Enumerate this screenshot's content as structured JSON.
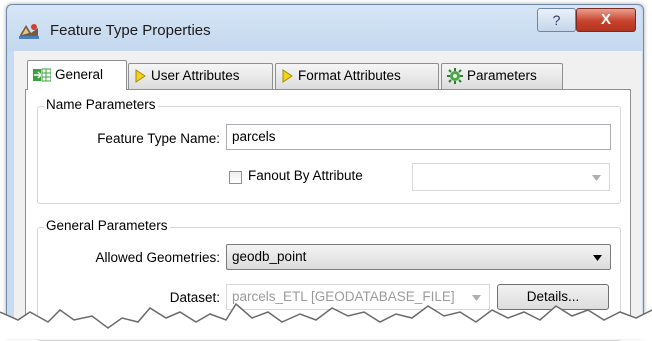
{
  "window": {
    "title": "Feature Type Properties",
    "help_glyph": "?",
    "close_glyph": "X"
  },
  "tabs": [
    {
      "label": "General",
      "icon": "table-icon",
      "active": true
    },
    {
      "label": "User Attributes",
      "icon": "diamond-icon",
      "active": false
    },
    {
      "label": "Format Attributes",
      "icon": "diamond-icon",
      "active": false
    },
    {
      "label": "Parameters",
      "icon": "gear-icon",
      "active": false
    }
  ],
  "name_parameters": {
    "group_label": "Name Parameters",
    "feature_type_name_label": "Feature Type Name:",
    "feature_type_name_value": "parcels",
    "fanout_label": "Fanout By Attribute",
    "fanout_checked": false
  },
  "general_parameters": {
    "group_label": "General Parameters",
    "allowed_geometries_label": "Allowed Geometries:",
    "allowed_geometries_value": "geodb_point",
    "dataset_label": "Dataset:",
    "dataset_value": "parcels_ETL [GEODATABASE_FILE]",
    "details_button": "Details..."
  },
  "colors": {
    "frame": "#c9dbee",
    "close_button": "#c8422c",
    "tab_border": "#8e8f8f"
  }
}
